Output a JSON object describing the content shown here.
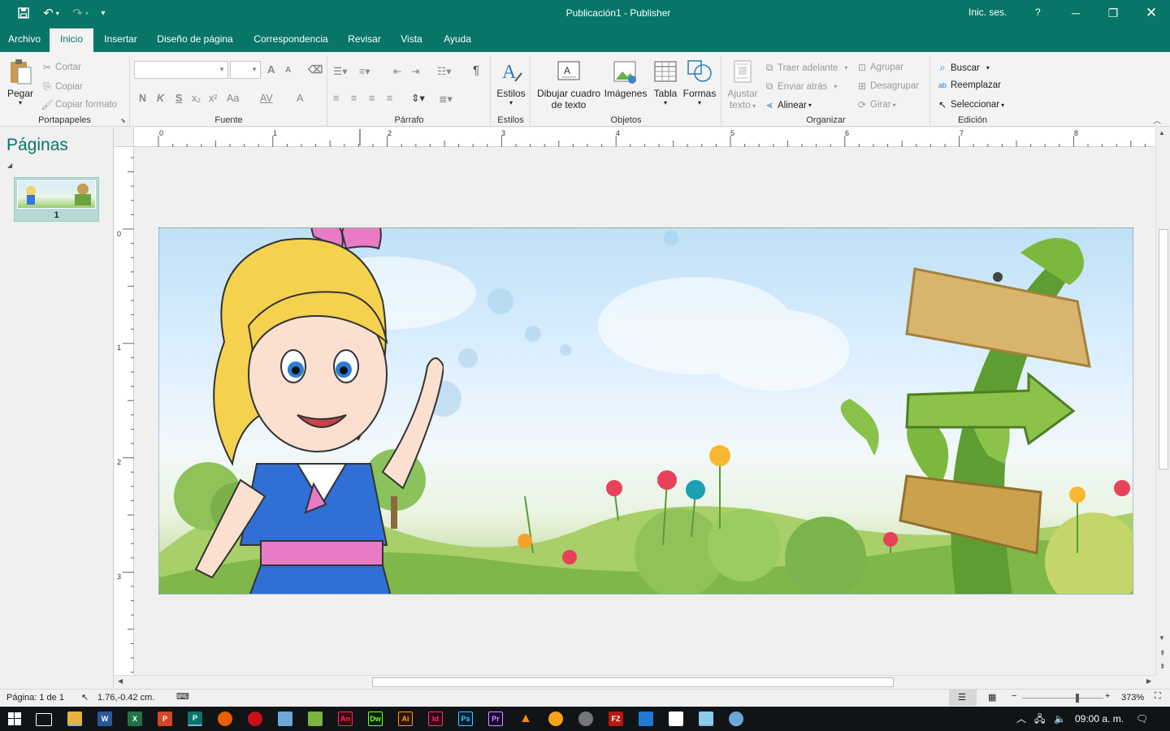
{
  "titlebar": {
    "document_title": "Publicación1  -  Publisher",
    "sign_in": "Inic. ses.",
    "help": "?"
  },
  "tabs": [
    {
      "label": "Archivo"
    },
    {
      "label": "Inicio"
    },
    {
      "label": "Insertar"
    },
    {
      "label": "Diseño de página"
    },
    {
      "label": "Correspondencia"
    },
    {
      "label": "Revisar"
    },
    {
      "label": "Vista"
    },
    {
      "label": "Ayuda"
    }
  ],
  "ribbon": {
    "portapapeles": {
      "label": "Portapapeles",
      "paste": "Pegar",
      "cut": "Cortar",
      "copy": "Copiar",
      "format_painter": "Copiar formato"
    },
    "fuente": {
      "label": "Fuente",
      "bold": "N",
      "italic": "K",
      "underline": "S",
      "subscript": "x₂",
      "superscript": "x²",
      "change_case": "Aa",
      "char_spacing": "AV",
      "font_color": "A",
      "grow": "A",
      "shrink": "A"
    },
    "parrafo": {
      "label": "Párrafo"
    },
    "estilos": {
      "label": "Estilos",
      "button": "Estilos"
    },
    "objetos": {
      "label": "Objetos",
      "draw_textbox_line1": "Dibujar cuadro",
      "draw_textbox_line2": "de texto",
      "images": "Imágenes",
      "table": "Tabla",
      "shapes": "Formas"
    },
    "organizar": {
      "label": "Organizar",
      "wrap_line1": "Ajustar",
      "wrap_line2": "texto",
      "bring_forward": "Traer adelante",
      "send_backward": "Enviar atrás",
      "align": "Alinear",
      "group": "Agrupar",
      "ungroup": "Desagrupar",
      "rotate": "Girar"
    },
    "edicion": {
      "label": "Edición",
      "find": "Buscar",
      "replace": "Reemplazar",
      "select": "Seleccionar"
    }
  },
  "pages_panel": {
    "title": "Páginas",
    "page_number": "1"
  },
  "rulers": {
    "horizontal": [
      "0",
      "1",
      "2",
      "3",
      "4",
      "5",
      "6",
      "7",
      "8"
    ],
    "vertical": [
      "0",
      "1",
      "2",
      "3"
    ]
  },
  "statusbar": {
    "page_info": "Página: 1 de 1",
    "position": "1.76,-0.42 cm.",
    "zoom": "373%"
  },
  "taskbar": {
    "clock": "09:00 a. m.",
    "apps": [
      "Explorador",
      "W",
      "X",
      "P",
      "P",
      "Firefox",
      "Opera",
      "3D",
      "Android",
      "An",
      "Dw",
      "Ai",
      "Id",
      "Ps",
      "Pr",
      "VLC",
      "Avast",
      "Chrome",
      "FZ",
      "App",
      "Box",
      "Notas",
      "Paint"
    ]
  },
  "colors": {
    "accent": "#077568",
    "ribbon_bg": "#f3f3f3",
    "taskbar_bg": "#101417"
  }
}
